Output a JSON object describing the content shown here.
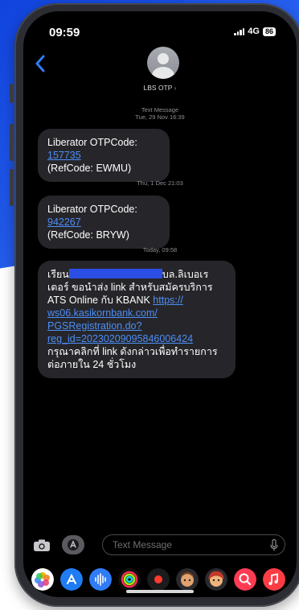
{
  "status_bar": {
    "time": "09:59",
    "network": "4G",
    "battery": "86"
  },
  "header": {
    "contact_name": "LBS OTP",
    "chevron": "›"
  },
  "thread": {
    "stamp1_line1": "Text Message",
    "stamp1_line2": "Tue, 29 Nov 16:39",
    "msg1_prefix": "Liberator OTPCode: ",
    "msg1_code": "157735",
    "msg1_ref": "(RefCode: EWMU)",
    "stamp2": "Thu, 1 Dec 21:03",
    "msg2_prefix": "Liberator OTPCode: ",
    "msg2_code": "942267",
    "msg2_ref": "(RefCode: BRYW)",
    "stamp3": "Today, 09:58",
    "msg3_greeting": "เรียน",
    "msg3_line1_end": "บล.ลิเบอเร",
    "msg3_line2": "เตอร์ ขอนำส่ง link สำหรับสมัครบริการ",
    "msg3_line3_prefix": "ATS Online กับ KBANK ",
    "msg3_link_1": "https://",
    "msg3_link_2": "ws06.kasikornbank.com/",
    "msg3_link_3": "PGSRegistration.do?",
    "msg3_link_4": "reg_id=20230209095846006424",
    "msg3_line4": "กรุณาคลิกที่ link ดังกล่าวเพื่อทำรายการ",
    "msg3_line5": "ต่อภายใน 24 ชั่วโมง"
  },
  "compose": {
    "placeholder": "Text Message"
  },
  "dock_icons": [
    "photos-icon",
    "app-store-icon",
    "audio-message-icon",
    "fitness-icon",
    "record-icon",
    "memoji-icon",
    "memoji-2-icon",
    "search-images-icon",
    "music-icon"
  ],
  "colors": {
    "background_blue": "#1f55e8",
    "bubble": "#26262a",
    "link": "#4d8ef7"
  }
}
